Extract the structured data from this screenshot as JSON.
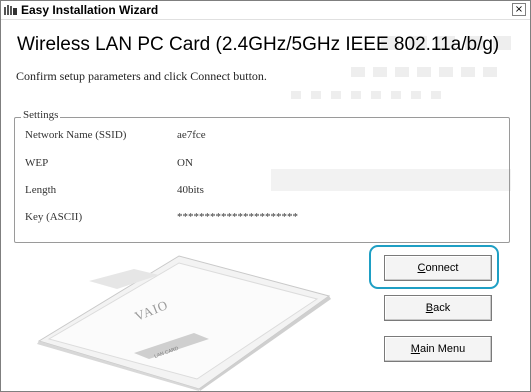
{
  "window": {
    "title": "Easy Installation Wizard",
    "close_glyph": "×"
  },
  "heading": "Wireless LAN PC Card (2.4GHz/5GHz IEEE 802.11a/b/g)",
  "instruction": "Confirm setup parameters and click Connect button.",
  "settings": {
    "legend": "Settings",
    "rows": [
      {
        "label": "Network Name (SSID)",
        "value": "ae7fce"
      },
      {
        "label": "WEP",
        "value": "ON"
      },
      {
        "label": "Length",
        "value": "40bits"
      },
      {
        "label": "Key (ASCII)",
        "value": "**********************"
      }
    ]
  },
  "image_text": {
    "brand": "VAIO",
    "card_label": "LAN CARD"
  },
  "buttons": {
    "connect": {
      "mnemonic": "C",
      "rest": "onnect"
    },
    "back": {
      "mnemonic": "B",
      "rest": "ack"
    },
    "main_menu": {
      "mnemonic": "M",
      "rest": "ain Menu"
    }
  },
  "colors": {
    "highlight": "#1e9fc4"
  }
}
